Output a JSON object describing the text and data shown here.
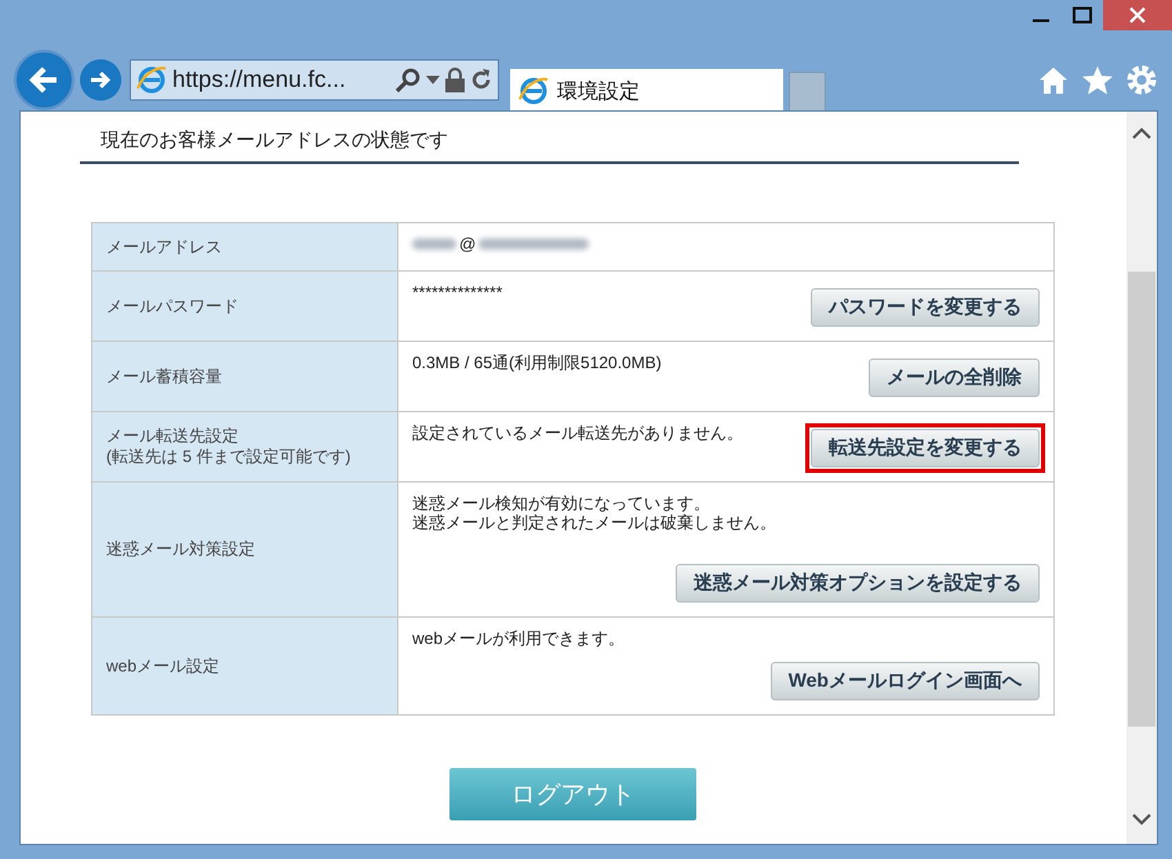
{
  "browser": {
    "address": "https://menu.fc...",
    "tab_title": "環境設定"
  },
  "heading": "現在のお客様メールアドレスの状態です",
  "rows": [
    {
      "label": [
        "メールアドレス"
      ],
      "kind": "email",
      "lines": [
        "@"
      ]
    },
    {
      "label": [
        "メールパスワード"
      ],
      "kind": "text",
      "lines": [
        "**************"
      ],
      "button": {
        "label": "パスワードを変更する",
        "highlighted": false
      }
    },
    {
      "label": [
        "メール蓄積容量"
      ],
      "kind": "text",
      "lines": [
        "0.3MB / 65通(利用制限5120.0MB)"
      ],
      "button": {
        "label": "メールの全削除",
        "highlighted": false
      }
    },
    {
      "label": [
        "メール転送先設定",
        "(転送先は 5 件まで設定可能です)"
      ],
      "kind": "text",
      "lines": [
        "設定されているメール転送先がありません。"
      ],
      "button": {
        "label": "転送先設定を変更する",
        "highlighted": true
      }
    },
    {
      "label": [
        "迷惑メール対策設定"
      ],
      "kind": "text",
      "lines": [
        "迷惑メール検知が有効になっています。",
        "迷惑メールと判定されたメールは破棄しません。"
      ],
      "button": {
        "label": "迷惑メール対策オプションを設定する",
        "highlighted": false
      }
    },
    {
      "label": [
        "webメール設定"
      ],
      "kind": "text",
      "lines": [
        "webメールが利用できます。"
      ],
      "button": {
        "label": "Webメールログイン画面へ",
        "highlighted": false
      }
    }
  ],
  "logout": "ログアウト"
}
